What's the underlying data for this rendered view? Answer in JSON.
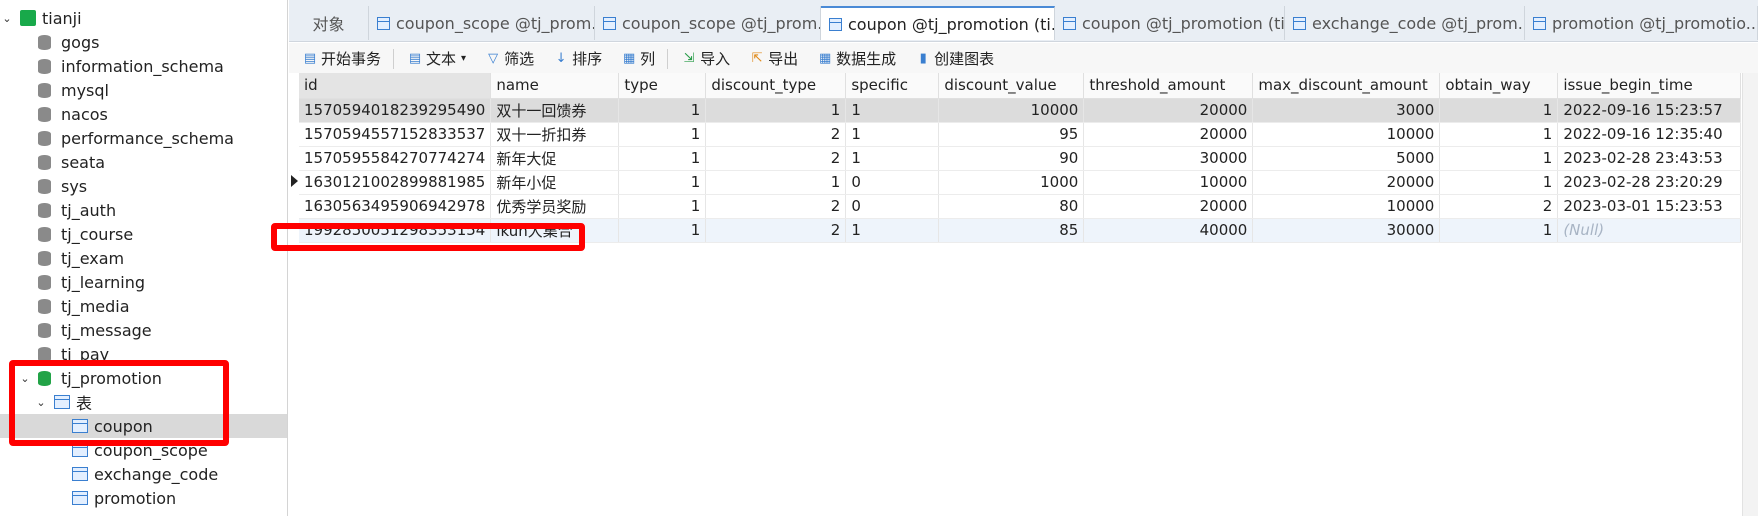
{
  "sidebar": {
    "connection": "tianji",
    "databases": [
      "gogs",
      "information_schema",
      "mysql",
      "nacos",
      "performance_schema",
      "seata",
      "sys",
      "tj_auth",
      "tj_course",
      "tj_exam",
      "tj_learning",
      "tj_media",
      "tj_message",
      "tj_pay",
      "tj_promotion"
    ],
    "tables_folder": "表",
    "tables": [
      "coupon",
      "coupon_scope",
      "exchange_code",
      "promotion"
    ]
  },
  "tabs": [
    {
      "label": "对象"
    },
    {
      "label": "coupon_scope @tj_prom..."
    },
    {
      "label": "coupon_scope @tj_prom..."
    },
    {
      "label": "coupon @tj_promotion (ti..."
    },
    {
      "label": "coupon @tj_promotion (ti..."
    },
    {
      "label": "exchange_code @tj_prom..."
    },
    {
      "label": "promotion @tj_promotio..."
    }
  ],
  "toolbar": {
    "begin_tx": "开始事务",
    "text": "文本",
    "filter": "筛选",
    "sort": "排序",
    "columns": "列",
    "import": "导入",
    "export": "导出",
    "generate": "数据生成",
    "chart": "创建图表"
  },
  "grid": {
    "columns": [
      "id",
      "name",
      "type",
      "discount_type",
      "specific",
      "discount_value",
      "threshold_amount",
      "max_discount_amount",
      "obtain_way",
      "issue_begin_time"
    ],
    "rows": [
      [
        "1570594018239295490",
        "双十一回馈券",
        "1",
        "1",
        "1",
        "10000",
        "20000",
        "3000",
        "1",
        "2022-09-16 15:23:57"
      ],
      [
        "1570594557152833537",
        "双十一折扣券",
        "1",
        "2",
        "1",
        "95",
        "20000",
        "10000",
        "1",
        "2022-09-16 12:35:40"
      ],
      [
        "1570595584270774274",
        "新年大促",
        "1",
        "2",
        "1",
        "90",
        "30000",
        "5000",
        "1",
        "2023-02-28 23:43:53"
      ],
      [
        "1630121002899881985",
        "新年小促",
        "1",
        "1",
        "0",
        "1000",
        "10000",
        "20000",
        "1",
        "2023-02-28 23:20:29"
      ],
      [
        "1630563495906942978",
        "优秀学员奖励",
        "1",
        "2",
        "0",
        "80",
        "20000",
        "10000",
        "2",
        "2023-03-01 15:23:53"
      ],
      [
        "1992850051298353154",
        "ikun大集合",
        "1",
        "2",
        "1",
        "85",
        "40000",
        "30000",
        "1",
        "(Null)"
      ]
    ]
  },
  "colors": {
    "highlight": "#ff0000",
    "accent": "#4a8ad6"
  }
}
